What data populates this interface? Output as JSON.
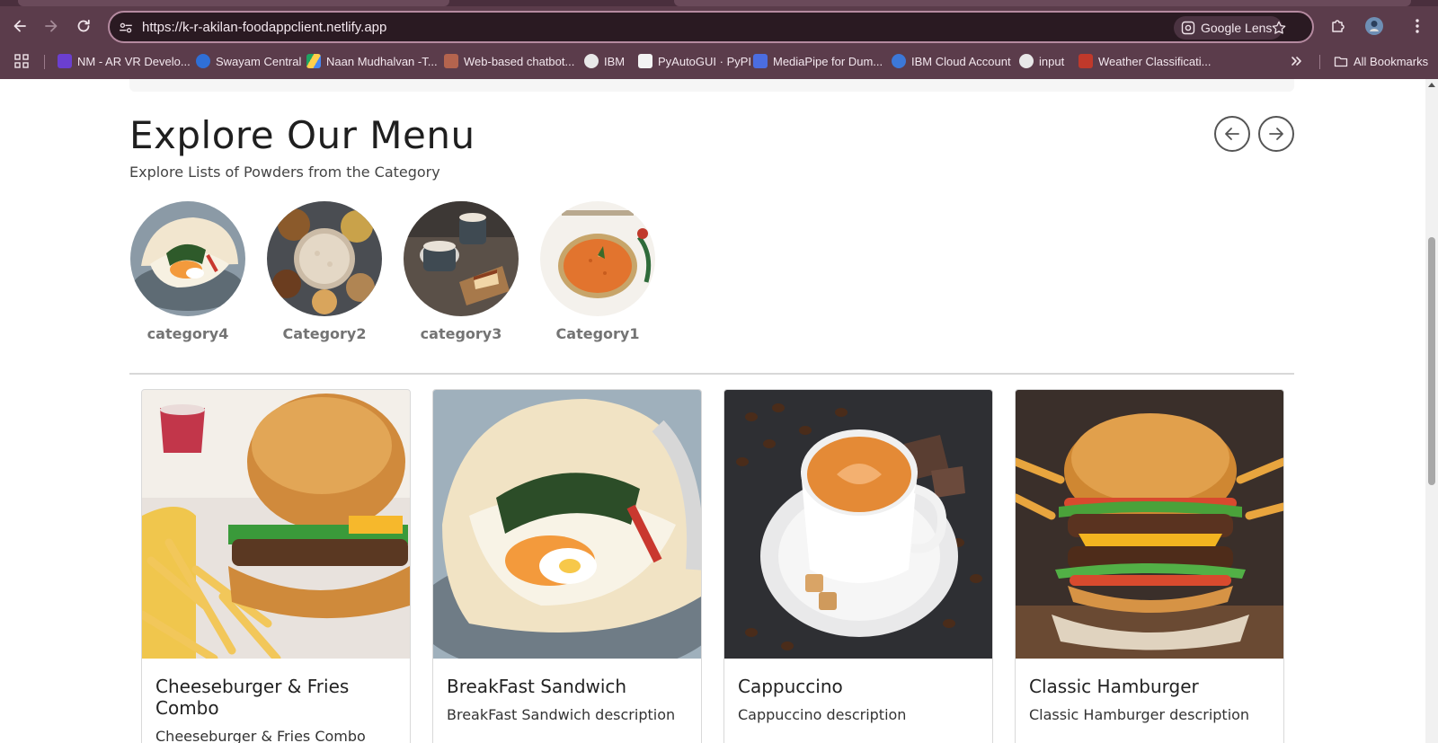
{
  "browser": {
    "url": "https://k-r-akilan-foodappclient.netlify.app",
    "lens_label": "Google Lens",
    "bookmarks": [
      {
        "label": "NM - AR VR Develo...",
        "color": "#6b3fd0"
      },
      {
        "label": "Swayam Central",
        "color": "#2f6fd6"
      },
      {
        "label": "Naan Mudhalvan -T...",
        "color": "#1fa463"
      },
      {
        "label": "Web-based chatbot...",
        "color": "#b4644e"
      },
      {
        "label": "IBM",
        "color": "#e8e8e8"
      },
      {
        "label": "PyAutoGUI · PyPI",
        "color": "#f3f3f3"
      },
      {
        "label": "MediaPipe for Dum...",
        "color": "#4b6de0"
      },
      {
        "label": "IBM Cloud Account",
        "color": "#3c78d8"
      },
      {
        "label": "input",
        "color": "#e8e8e8"
      },
      {
        "label": "Weather Classificati...",
        "color": "#c0392b"
      }
    ],
    "all_bookmarks_label": "All Bookmarks"
  },
  "menu": {
    "title": "Explore Our Menu",
    "subtitle": "Explore Lists of Powders from the Category",
    "categories": [
      {
        "label": "category4"
      },
      {
        "label": "Category2"
      },
      {
        "label": "category3"
      },
      {
        "label": "Category1"
      }
    ]
  },
  "cards": [
    {
      "title": "Cheeseburger & Fries Combo",
      "description": "Cheeseburger & Fries Combo"
    },
    {
      "title": "BreakFast Sandwich",
      "description": "BreakFast Sandwich description"
    },
    {
      "title": "Cappuccino",
      "description": "Cappuccino description"
    },
    {
      "title": "Classic Hamburger",
      "description": "Classic Hamburger description"
    }
  ],
  "colors": {
    "chrome_bg": "#5b3c4b",
    "omnibox_bg": "#2a1a22",
    "title_text": "#1f1f1f",
    "category_label": "#747474",
    "divider": "#d8d8d8"
  }
}
